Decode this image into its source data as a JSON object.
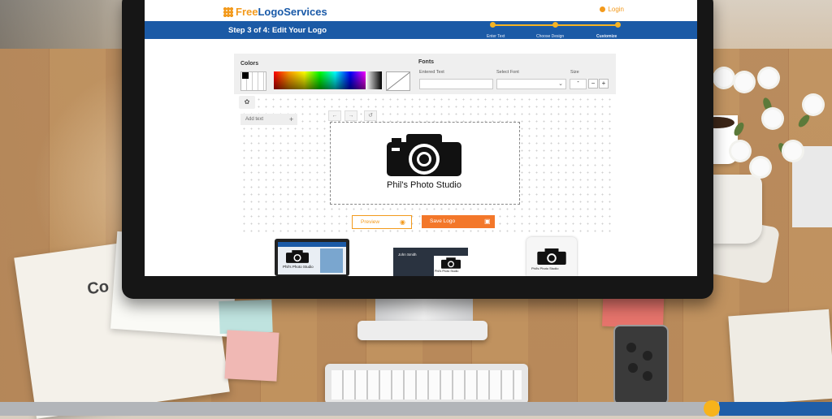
{
  "header": {
    "logo_free": "Free",
    "logo_rest": "LogoServices",
    "login_label": "Login"
  },
  "steps": {
    "title": "Step 3 of 4: Edit Your Logo",
    "items": [
      {
        "label": "Enter Text"
      },
      {
        "label": "Choose Design"
      },
      {
        "label": "Customize"
      }
    ]
  },
  "colors_panel": {
    "label": "Colors"
  },
  "fonts_panel": {
    "label": "Fonts",
    "entered_text_label": "Entered Text",
    "entered_text_value": "",
    "select_font_label": "Select Font",
    "select_font_value": "",
    "size_label": "Size",
    "size_value": "-"
  },
  "toolbar": {
    "add_text_label": "Add text",
    "add_symbol": "+",
    "minus_symbol": "−",
    "plus_symbol": "+"
  },
  "logo": {
    "caption": "Phil's Photo Studio",
    "icon": "camera-icon"
  },
  "actions": {
    "preview_label": "Preview",
    "save_label": "Save Logo"
  },
  "mockups": {
    "laptop_caption": "Phil's Photo Studio",
    "card_name": "John Smith",
    "card_caption": "Phil's Photo Studio",
    "tee_caption": "Phil's Photo Studio"
  },
  "paper": {
    "heading": "Co"
  },
  "colors": {
    "brand_blue": "#1b5aa6",
    "brand_orange": "#f39a1c",
    "save_orange": "#f3772a",
    "progress_yellow": "#f5b324"
  }
}
